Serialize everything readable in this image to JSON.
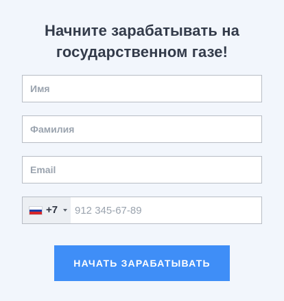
{
  "heading": {
    "line1": "Начните зарабатывать на",
    "line2": "государственном газе!"
  },
  "form": {
    "first_name_placeholder": "Имя",
    "last_name_placeholder": "Фамилия",
    "email_placeholder": "Email",
    "phone": {
      "country_flag": "russia-flag-icon",
      "dial_code": "+7",
      "placeholder": "912 345-67-89"
    },
    "submit_label": "НАЧАТЬ ЗАРАБАТЫВАТЬ"
  },
  "colors": {
    "background": "#f2f6fc",
    "title": "#333b4a",
    "button": "#3f8ef7",
    "border": "#b7bcc4"
  }
}
